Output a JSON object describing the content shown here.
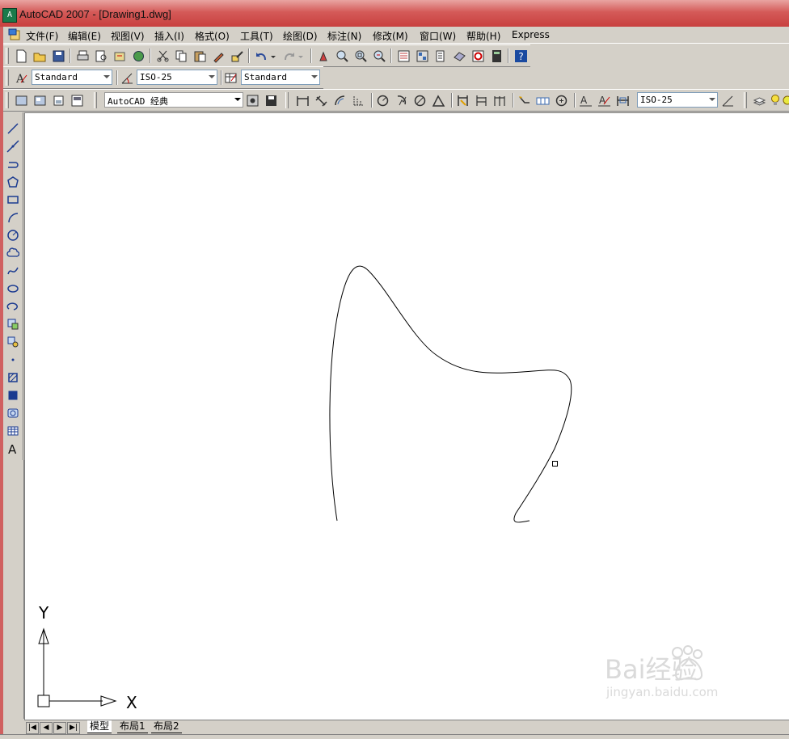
{
  "window": {
    "title": "AutoCAD 2007 - [Drawing1.dwg]"
  },
  "menu": [
    "文件(F)",
    "编辑(E)",
    "视图(V)",
    "插入(I)",
    "格式(O)",
    "工具(T)",
    "绘图(D)",
    "标注(N)",
    "修改(M)",
    "窗口(W)",
    "帮助(H)",
    "Express"
  ],
  "styles_toolbar": {
    "text_style": "Standard",
    "dim_style": "ISO-25",
    "table_style": "Standard"
  },
  "workspace_toolbar": {
    "workspace": "AutoCAD 经典",
    "dim_style": "ISO-25"
  },
  "ucs": {
    "x_label": "X",
    "y_label": "Y"
  },
  "layout_tabs": [
    "模型",
    "布局1",
    "布局2"
  ],
  "watermark": {
    "brand": "Bai经验",
    "url": "jingyan.baidu.com"
  },
  "colors": {
    "title_bar": "#c8403f",
    "chrome": "#d4d0c8",
    "canvas": "#ffffff"
  }
}
